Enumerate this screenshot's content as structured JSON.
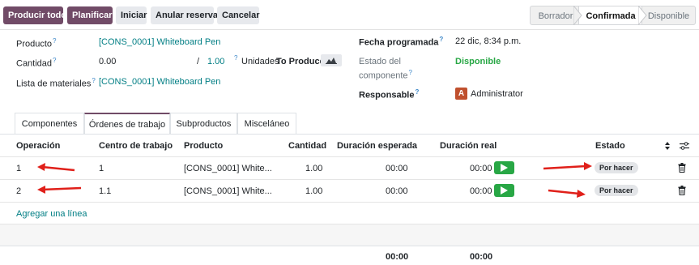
{
  "toolbar": {
    "buttons": {
      "produce_all": "Producir todo",
      "plan": "Planificar",
      "start": "Iniciar",
      "unreserve": "Anular reserva",
      "cancel": "Cancelar"
    },
    "stages": {
      "draft": "Borrador",
      "confirmed": "Confirmada",
      "available": "Disponible"
    },
    "active_stage": "Confirmada"
  },
  "form": {
    "product_label": "Producto",
    "product_value": "[CONS_0001] Whiteboard Pen",
    "quantity_label": "Cantidad",
    "quantity_produced": "0.00",
    "quantity_separator": "/",
    "quantity_total": "1.00",
    "units_label": "Unidades",
    "to_produce_label": "To Produce",
    "bom_label": "Lista de materiales",
    "bom_value": "[CONS_0001] Whiteboard Pen",
    "scheduled_label": "Fecha programada",
    "scheduled_value": "22 dic, 8:34 p.m.",
    "component_status_label_line1": "Estado del",
    "component_status_label_line2": "componente",
    "component_status_value": "Disponible",
    "responsible_label": "Responsable",
    "responsible_initial": "A",
    "responsible_value": "Administrator",
    "help_mark": "?"
  },
  "tabs": {
    "components": "Componentes",
    "work_orders": "Órdenes de trabajo",
    "by_products": "Subproductos",
    "misc": "Misceláneo",
    "active": "Órdenes de trabajo"
  },
  "table": {
    "headers": {
      "operation": "Operación",
      "work_center": "Centro de trabajo",
      "product": "Producto",
      "quantity": "Cantidad",
      "expected_duration": "Duración esperada",
      "real_duration": "Duración real",
      "status": "Estado"
    },
    "rows": [
      {
        "operation": "1",
        "work_center": "1",
        "product": "[CONS_0001] White...",
        "quantity": "1.00",
        "expected": "00:00",
        "real": "00:00",
        "status": "Por hacer"
      },
      {
        "operation": "2",
        "work_center": "1.1",
        "product": "[CONS_0001] White...",
        "quantity": "1.00",
        "expected": "00:00",
        "real": "00:00",
        "status": "Por hacer"
      }
    ],
    "add_line": "Agregar una línea",
    "totals": {
      "expected": "00:00",
      "real": "00:00"
    }
  },
  "annotations": {
    "arrow_color": "#e0201a"
  },
  "colors": {
    "primary": "#714b67",
    "link": "#017e84",
    "success": "#28a745"
  }
}
